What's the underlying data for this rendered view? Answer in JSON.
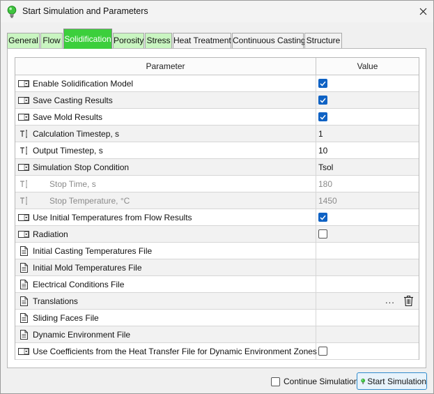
{
  "window": {
    "title": "Start Simulation and Parameters"
  },
  "tabs": [
    {
      "label": "General",
      "state": "green"
    },
    {
      "label": "Flow",
      "state": "green"
    },
    {
      "label": "Solidification",
      "state": "active"
    },
    {
      "label": "Porosity",
      "state": "green"
    },
    {
      "label": "Stress",
      "state": "green"
    },
    {
      "label": "Heat Treatment",
      "state": "plain"
    },
    {
      "label": "Continuous Casting",
      "state": "plain"
    },
    {
      "label": "Structure",
      "state": "plain"
    }
  ],
  "table": {
    "columns": [
      "Parameter",
      "Value"
    ],
    "rows": [
      {
        "icon": "dropdown-icon",
        "label": "Enable Solidification Model",
        "type": "checkbox",
        "checked": true
      },
      {
        "icon": "dropdown-icon",
        "label": "Save Casting Results",
        "type": "checkbox",
        "checked": true
      },
      {
        "icon": "dropdown-icon",
        "label": "Save Mold Results",
        "type": "checkbox",
        "checked": true
      },
      {
        "icon": "text-field-icon",
        "label": "Calculation Timestep, s",
        "type": "text",
        "value": "1"
      },
      {
        "icon": "text-field-icon",
        "label": "Output Timestep, s",
        "type": "text",
        "value": "10"
      },
      {
        "icon": "dropdown-icon",
        "label": "Simulation Stop Condition",
        "type": "text",
        "value": "Tsol"
      },
      {
        "icon": "text-field-icon",
        "label": "Stop Time, s",
        "type": "text",
        "value": "180",
        "disabled": true,
        "indent": true
      },
      {
        "icon": "text-field-icon",
        "label": "Stop Temperature, °C",
        "type": "text",
        "value": "1450",
        "disabled": true,
        "indent": true
      },
      {
        "icon": "dropdown-icon",
        "label": "Use Initial Temperatures from Flow Results",
        "type": "checkbox",
        "checked": true
      },
      {
        "icon": "dropdown-icon",
        "label": "Radiation",
        "type": "checkbox",
        "checked": false
      },
      {
        "icon": "file-icon",
        "label": "Initial Casting Temperatures File",
        "type": "empty"
      },
      {
        "icon": "file-icon",
        "label": "Initial Mold Temperatures File",
        "type": "empty"
      },
      {
        "icon": "file-icon",
        "label": "Electrical Conditions File",
        "type": "empty"
      },
      {
        "icon": "file-icon",
        "label": "Translations",
        "type": "actions",
        "more": "...",
        "delete_icon": "trash-icon"
      },
      {
        "icon": "file-icon",
        "label": "Sliding Faces File",
        "type": "empty"
      },
      {
        "icon": "file-icon",
        "label": "Dynamic Environment File",
        "type": "empty"
      },
      {
        "icon": "dropdown-icon",
        "label": "Use Coefficients from the Heat Transfer File for Dynamic Environment Zones",
        "type": "checkbox",
        "checked": false
      }
    ]
  },
  "footer": {
    "continue_label": "Continue Simulation",
    "continue_checked": false,
    "start_label": "Start Simulation"
  },
  "colors": {
    "tab_green": "#c9f5c1",
    "tab_active": "#3ccf3c",
    "checkbox_blue": "#0f62c4",
    "button_border": "#2f8bcc"
  }
}
